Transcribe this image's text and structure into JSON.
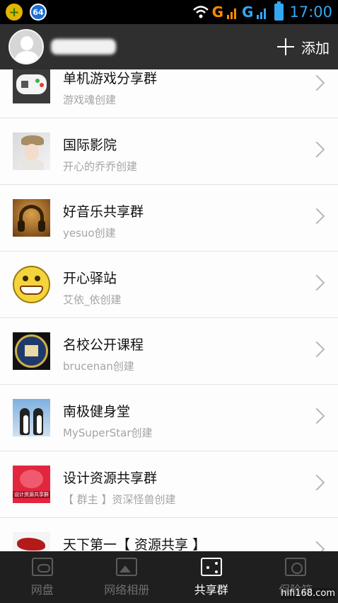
{
  "status_bar": {
    "notif_count": "64",
    "network_1": "G",
    "network_2": "G",
    "time": "17:00"
  },
  "header": {
    "add_label": "添加"
  },
  "groups": [
    {
      "title": "单机游戏分享群",
      "creator": "游戏魂创建",
      "icon": "gamepad-thumbnail"
    },
    {
      "title": "国际影院",
      "creator": "开心的乔乔创建",
      "icon": "movie-thumbnail"
    },
    {
      "title": "好音乐共享群",
      "creator": "yesuo创建",
      "icon": "music-thumbnail"
    },
    {
      "title": "开心驿站",
      "creator": "艾依_依创建",
      "icon": "smiley-thumbnail"
    },
    {
      "title": "名校公开课程",
      "creator": "brucenan创建",
      "icon": "school-thumbnail"
    },
    {
      "title": "南极健身堂",
      "creator": "MySuperStar创建",
      "icon": "penguin-thumbnail"
    },
    {
      "title": "设计资源共享群",
      "creator": "【 群主 】资深怪兽创建",
      "icon": "design-thumbnail"
    },
    {
      "title": "天下第一【 资源共享 】",
      "creator": "",
      "icon": "dragon-thumbnail"
    }
  ],
  "bottom_nav": [
    {
      "label": "网盘",
      "icon": "cloud-drive-icon",
      "active": false
    },
    {
      "label": "网络相册",
      "icon": "photo-album-icon",
      "active": false
    },
    {
      "label": "共享群",
      "icon": "share-group-icon",
      "active": true
    },
    {
      "label": "保险箱",
      "icon": "safe-icon",
      "active": false
    }
  ],
  "watermark": "hifi168.com",
  "colors": {
    "header_bg": "#2f2f2f",
    "nav_bg": "#1f1f1f",
    "status_accent": "#34a7f3",
    "network_accent": "#ff8a00"
  }
}
